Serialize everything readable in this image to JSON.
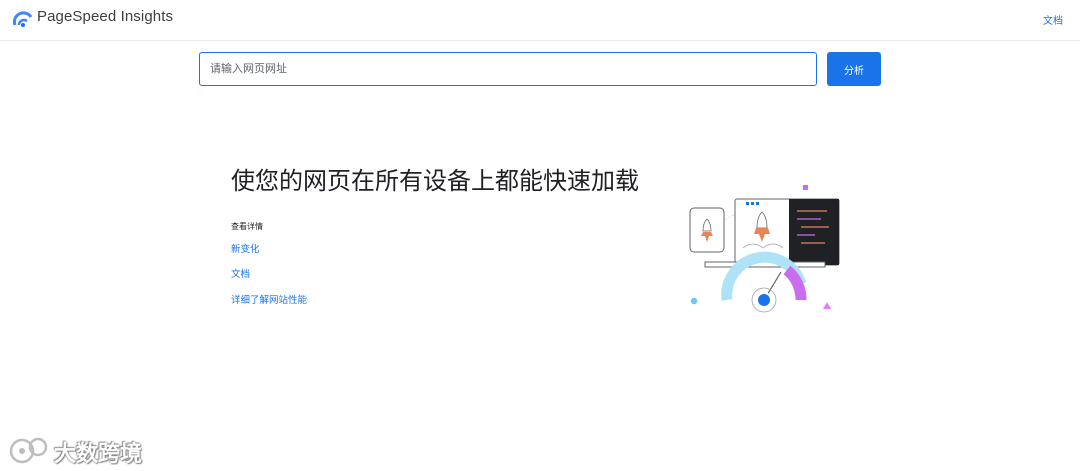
{
  "header": {
    "brand": "PageSpeed Insights",
    "docs_link": "文档",
    "logo_icon": "pagespeed-logo-icon"
  },
  "search": {
    "placeholder": "请输入网页网址",
    "value": "",
    "button_label": "分析"
  },
  "hero": {
    "headline": "使您的网页在所有设备上都能快速加载",
    "details_label": "查看详情",
    "links": [
      "新变化",
      "文档",
      "详细了解网站性能"
    ],
    "illustration_icon": "devices-speed-gauge-illustration"
  },
  "watermark": {
    "text": "大数跨境",
    "icon": "watermark-logo-icon"
  },
  "colors": {
    "accent": "#1a73e8",
    "gauge_purple": "#c96cf0",
    "gauge_light": "#aee3f7"
  }
}
